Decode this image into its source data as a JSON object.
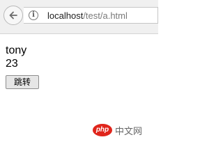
{
  "browser": {
    "url_host": "localhost",
    "url_path": "/test/a.html",
    "info_icon_glyph": "i",
    "back_icon": "arrow-left-icon"
  },
  "page": {
    "name": "tony",
    "age": "23",
    "jump_button_label": "跳转"
  },
  "watermark": {
    "logo_text": "php",
    "site_text": "中文网",
    "logo_color": "#e0251b"
  }
}
